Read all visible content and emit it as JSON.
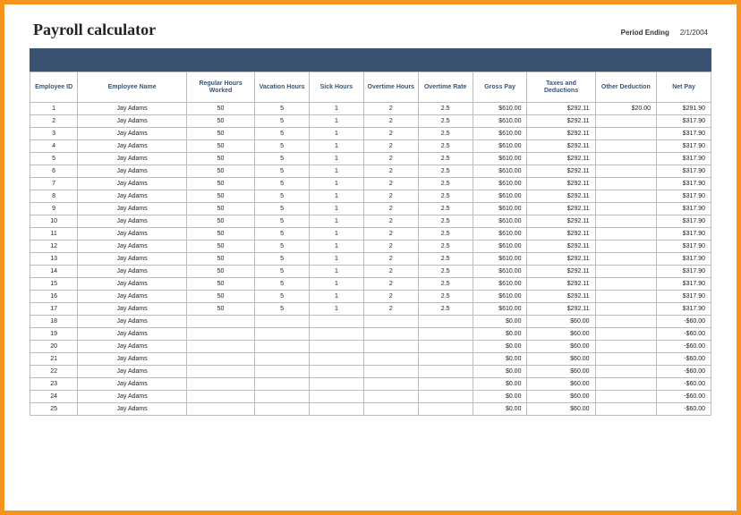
{
  "title": "Payroll calculator",
  "period_label": "Period Ending",
  "period_value": "2/1/2004",
  "columns": [
    "Employee ID",
    "Employee Name",
    "Regular Hours Worked",
    "Vacation Hours",
    "Sick Hours",
    "Overtime Hours",
    "Overtime Rate",
    "Gross Pay",
    "Taxes and Deductions",
    "Other Deduction",
    "Net Pay"
  ],
  "rows": [
    {
      "id": "1",
      "name": "Jay Adams",
      "reg": "50",
      "vac": "5",
      "sick": "1",
      "oth": "2",
      "otr": "2.5",
      "gross": "$610.00",
      "tax": "$292.11",
      "other": "$20.00",
      "net": "$291.90"
    },
    {
      "id": "2",
      "name": "Jay Adams",
      "reg": "50",
      "vac": "5",
      "sick": "1",
      "oth": "2",
      "otr": "2.5",
      "gross": "$610.00",
      "tax": "$292.11",
      "other": "",
      "net": "$317.90"
    },
    {
      "id": "3",
      "name": "Jay Adams",
      "reg": "50",
      "vac": "5",
      "sick": "1",
      "oth": "2",
      "otr": "2.5",
      "gross": "$610.00",
      "tax": "$292.11",
      "other": "",
      "net": "$317.90"
    },
    {
      "id": "4",
      "name": "Jay Adams",
      "reg": "50",
      "vac": "5",
      "sick": "1",
      "oth": "2",
      "otr": "2.5",
      "gross": "$610.00",
      "tax": "$292.11",
      "other": "",
      "net": "$317.90"
    },
    {
      "id": "5",
      "name": "Jay Adams",
      "reg": "50",
      "vac": "5",
      "sick": "1",
      "oth": "2",
      "otr": "2.5",
      "gross": "$610.00",
      "tax": "$292.11",
      "other": "",
      "net": "$317.90"
    },
    {
      "id": "6",
      "name": "Jay Adams",
      "reg": "50",
      "vac": "5",
      "sick": "1",
      "oth": "2",
      "otr": "2.5",
      "gross": "$610.00",
      "tax": "$292.11",
      "other": "",
      "net": "$317.90"
    },
    {
      "id": "7",
      "name": "Jay Adams",
      "reg": "50",
      "vac": "5",
      "sick": "1",
      "oth": "2",
      "otr": "2.5",
      "gross": "$610.00",
      "tax": "$292.11",
      "other": "",
      "net": "$317.90"
    },
    {
      "id": "8",
      "name": "Jay Adams",
      "reg": "50",
      "vac": "5",
      "sick": "1",
      "oth": "2",
      "otr": "2.5",
      "gross": "$610.00",
      "tax": "$292.11",
      "other": "",
      "net": "$317.90"
    },
    {
      "id": "9",
      "name": "Jay Adams",
      "reg": "50",
      "vac": "5",
      "sick": "1",
      "oth": "2",
      "otr": "2.5",
      "gross": "$610.00",
      "tax": "$292.11",
      "other": "",
      "net": "$317.90"
    },
    {
      "id": "10",
      "name": "Jay Adams",
      "reg": "50",
      "vac": "5",
      "sick": "1",
      "oth": "2",
      "otr": "2.5",
      "gross": "$610.00",
      "tax": "$292.11",
      "other": "",
      "net": "$317.90"
    },
    {
      "id": "11",
      "name": "Jay Adams",
      "reg": "50",
      "vac": "5",
      "sick": "1",
      "oth": "2",
      "otr": "2.5",
      "gross": "$610.00",
      "tax": "$292.11",
      "other": "",
      "net": "$317.90"
    },
    {
      "id": "12",
      "name": "Jay Adams",
      "reg": "50",
      "vac": "5",
      "sick": "1",
      "oth": "2",
      "otr": "2.5",
      "gross": "$610.00",
      "tax": "$292.11",
      "other": "",
      "net": "$317.90"
    },
    {
      "id": "13",
      "name": "Jay Adams",
      "reg": "50",
      "vac": "5",
      "sick": "1",
      "oth": "2",
      "otr": "2.5",
      "gross": "$610.00",
      "tax": "$292.11",
      "other": "",
      "net": "$317.90"
    },
    {
      "id": "14",
      "name": "Jay Adams",
      "reg": "50",
      "vac": "5",
      "sick": "1",
      "oth": "2",
      "otr": "2.5",
      "gross": "$610.00",
      "tax": "$292.11",
      "other": "",
      "net": "$317.90"
    },
    {
      "id": "15",
      "name": "Jay Adams",
      "reg": "50",
      "vac": "5",
      "sick": "1",
      "oth": "2",
      "otr": "2.5",
      "gross": "$610.00",
      "tax": "$292.11",
      "other": "",
      "net": "$317.90"
    },
    {
      "id": "16",
      "name": "Jay Adams",
      "reg": "50",
      "vac": "5",
      "sick": "1",
      "oth": "2",
      "otr": "2.5",
      "gross": "$610.00",
      "tax": "$292.11",
      "other": "",
      "net": "$317.90"
    },
    {
      "id": "17",
      "name": "Jay Adams",
      "reg": "50",
      "vac": "5",
      "sick": "1",
      "oth": "2",
      "otr": "2.5",
      "gross": "$610.00",
      "tax": "$292.11",
      "other": "",
      "net": "$317.90"
    },
    {
      "id": "18",
      "name": "Jay Adams",
      "reg": "",
      "vac": "",
      "sick": "",
      "oth": "",
      "otr": "",
      "gross": "$0.00",
      "tax": "$60.00",
      "other": "",
      "net": "-$60.00"
    },
    {
      "id": "19",
      "name": "Jay Adams",
      "reg": "",
      "vac": "",
      "sick": "",
      "oth": "",
      "otr": "",
      "gross": "$0.00",
      "tax": "$60.00",
      "other": "",
      "net": "-$60.00"
    },
    {
      "id": "20",
      "name": "Jay Adams",
      "reg": "",
      "vac": "",
      "sick": "",
      "oth": "",
      "otr": "",
      "gross": "$0.00",
      "tax": "$60.00",
      "other": "",
      "net": "-$60.00"
    },
    {
      "id": "21",
      "name": "Jay Adams",
      "reg": "",
      "vac": "",
      "sick": "",
      "oth": "",
      "otr": "",
      "gross": "$0.00",
      "tax": "$60.00",
      "other": "",
      "net": "-$60.00"
    },
    {
      "id": "22",
      "name": "Jay Adams",
      "reg": "",
      "vac": "",
      "sick": "",
      "oth": "",
      "otr": "",
      "gross": "$0.00",
      "tax": "$60.00",
      "other": "",
      "net": "-$60.00"
    },
    {
      "id": "23",
      "name": "Jay Adams",
      "reg": "",
      "vac": "",
      "sick": "",
      "oth": "",
      "otr": "",
      "gross": "$0.00",
      "tax": "$60.00",
      "other": "",
      "net": "-$60.00"
    },
    {
      "id": "24",
      "name": "Jay Adams",
      "reg": "",
      "vac": "",
      "sick": "",
      "oth": "",
      "otr": "",
      "gross": "$0.00",
      "tax": "$60.00",
      "other": "",
      "net": "-$60.00"
    },
    {
      "id": "25",
      "name": "Jay Adams",
      "reg": "",
      "vac": "",
      "sick": "",
      "oth": "",
      "otr": "",
      "gross": "$0.00",
      "tax": "$60.00",
      "other": "",
      "net": "-$60.00"
    }
  ]
}
